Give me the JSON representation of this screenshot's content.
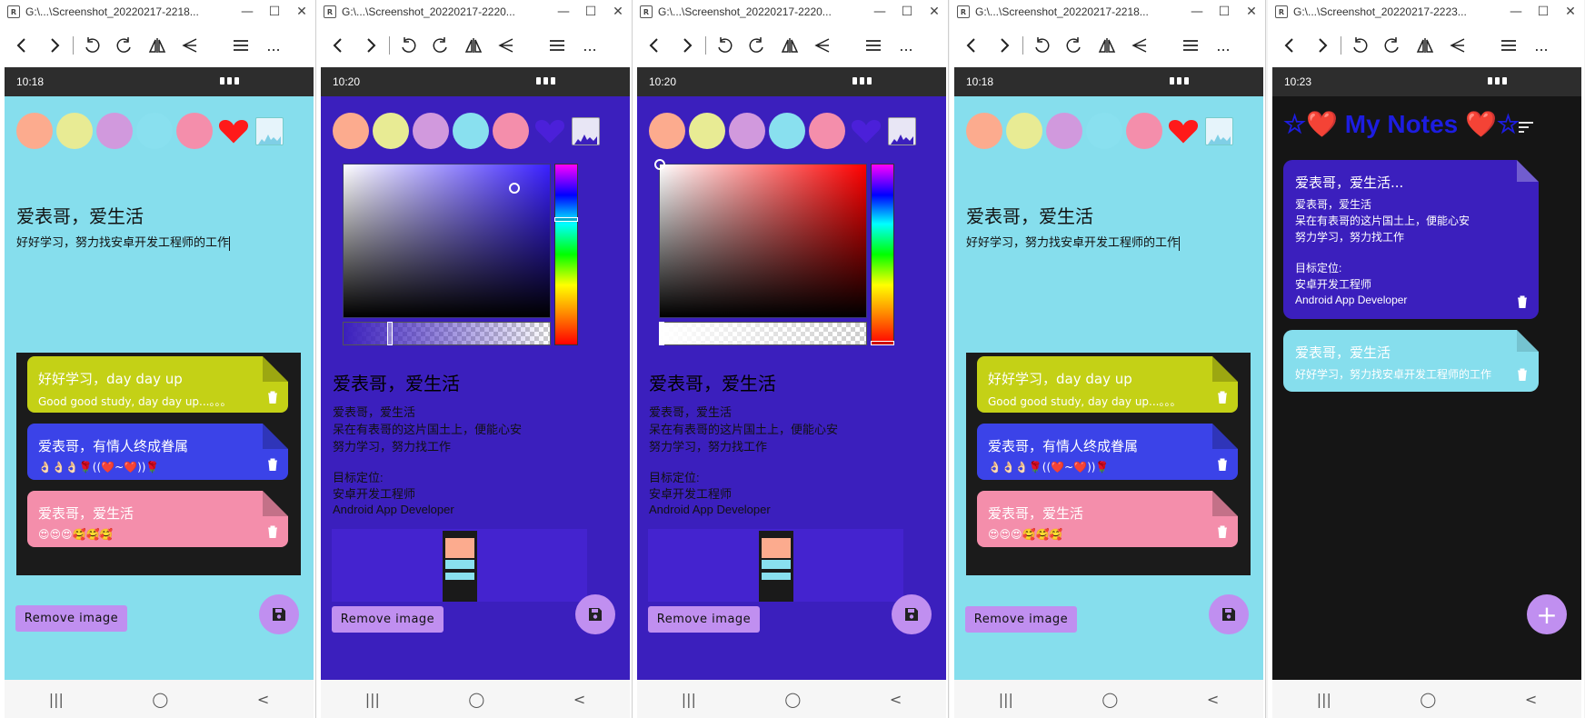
{
  "windows": [
    {
      "title": "G:\\...\\Screenshot_20220217-2218...",
      "time": "10:18"
    },
    {
      "title": "G:\\...\\Screenshot_20220217-2220...",
      "time": "10:20"
    },
    {
      "title": "G:\\...\\Screenshot_20220217-2220...",
      "time": "10:20"
    },
    {
      "title": "G:\\...\\Screenshot_20220217-2218...",
      "time": "10:18"
    },
    {
      "title": "G:\\...\\Screenshot_20220217-2223...",
      "time": "10:23"
    }
  ],
  "window_controls": {
    "minimize": "—",
    "maximize": "☐",
    "close": "✕"
  },
  "toolbar": {
    "more": "..."
  },
  "navbar": {
    "recents": "|||",
    "home": "◯",
    "back": "<"
  },
  "colors": {
    "peach": "#fcab8e",
    "yellow": "#e8eb94",
    "lavender": "#d199dd",
    "cyan": "#89e0ef",
    "pink": "#f48eab",
    "heart_red": "#ff1a1a",
    "heart_purple": "#4b20d9",
    "bg_cyan": "#86deed",
    "bg_purple": "#3b1fbd",
    "accent": "#c08ff0"
  },
  "editor1": {
    "title": "爱表哥，爱生活",
    "subtitle": "好好学习，努力找安卓开发工程师的工作",
    "cards": [
      {
        "title": "好好学习，day day up",
        "body": "Good good study, day day up...。。。"
      },
      {
        "title": "爱表哥，有情人终成眷属",
        "body": "👌🏻👌🏻👌🏻🌹((❤️~❤️))🌹"
      },
      {
        "title": "爱表哥，爱生活",
        "body": "😍😍😍🥰🥰🥰"
      }
    ],
    "remove_label": "Remove image"
  },
  "editor2": {
    "title": "爱表哥，爱生活",
    "body_lines": [
      "爱表哥，爱生活",
      "呆在有表哥的这片国土上，便能心安",
      "努力学习，努力找工作",
      "",
      "目标定位:",
      "安卓开发工程师",
      "Android App Developer"
    ],
    "remove_label": "Remove image"
  },
  "list": {
    "header": "☆❤️ My Notes ❤️☆",
    "notes": [
      {
        "title": "爱表哥，爱生活...",
        "lines": [
          "爱表哥，爱生活",
          "呆在有表哥的这片国土上，便能心安",
          "努力学习，努力找工作",
          "",
          "目标定位:",
          "安卓开发工程师",
          "Android App Developer"
        ]
      },
      {
        "title": "爱表哥，爱生活",
        "lines": [
          "好好学习，努力找安卓开发工程师的工作"
        ]
      }
    ],
    "add_label": "+"
  }
}
